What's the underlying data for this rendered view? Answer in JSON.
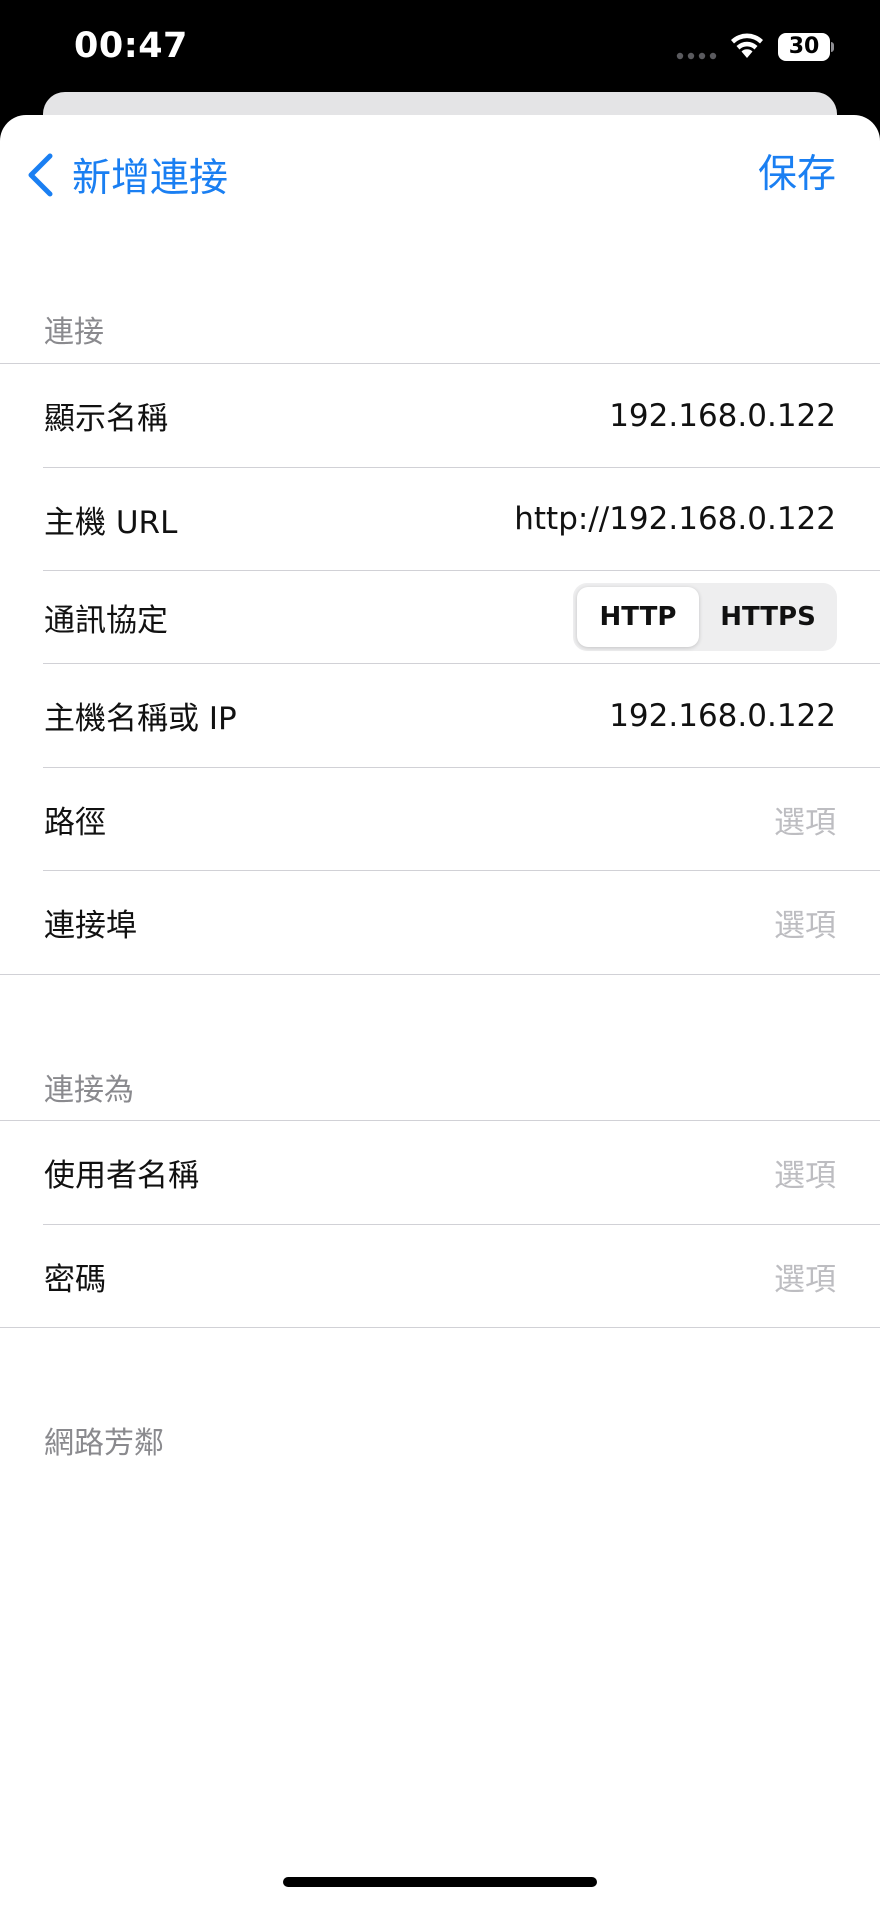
{
  "status_bar": {
    "time": "00:47",
    "battery": "30"
  },
  "nav": {
    "back_label": "新增連接",
    "save_label": "保存"
  },
  "section_connection": {
    "header": "連接",
    "rows": [
      {
        "label": "顯示名稱",
        "value": "192.168.0.122"
      },
      {
        "label": "主機 URL",
        "value": "http://192.168.0.122"
      },
      {
        "label": "通訊協定"
      },
      {
        "label": "主機名稱或 IP",
        "value": "192.168.0.122"
      },
      {
        "label": "路徑",
        "placeholder": "選項"
      },
      {
        "label": "連接埠",
        "placeholder": "選項"
      }
    ],
    "protocol_options": [
      "HTTP",
      "HTTPS"
    ],
    "protocol_selected": "HTTP"
  },
  "section_connect_as": {
    "header": "連接為",
    "rows": [
      {
        "label": "使用者名稱",
        "placeholder": "選項"
      },
      {
        "label": "密碼",
        "placeholder": "選項"
      }
    ]
  },
  "section_network": {
    "header": "網路芳鄰"
  },
  "colors": {
    "accent": "#1a7ff2",
    "placeholder": "#bdbdc1",
    "section_header": "#8a8a8e"
  }
}
